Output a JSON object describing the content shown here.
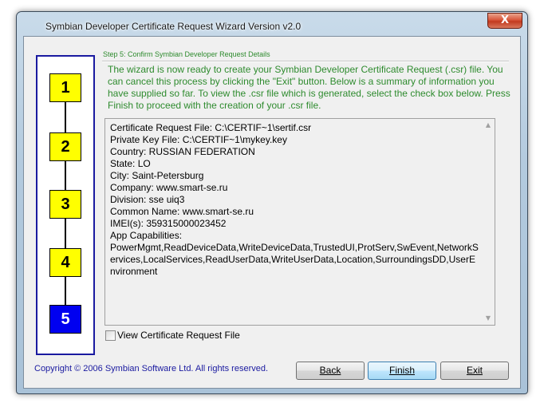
{
  "window": {
    "title": "Symbian Developer Certificate Request Wizard Version v2.0",
    "close_label": "X"
  },
  "steps": [
    {
      "label": "1",
      "active": false
    },
    {
      "label": "2",
      "active": false
    },
    {
      "label": "3",
      "active": false
    },
    {
      "label": "4",
      "active": false
    },
    {
      "label": "5",
      "active": true
    }
  ],
  "page": {
    "heading": "Step 5: Confirm Symbian Developer Request Details",
    "intro": "The wizard is now ready to create your Symbian Developer Certificate Request (.csr) file. You can cancel this process by clicking the \"Exit\" button. Below is a summary of information you have supplied so far. To view the .csr file which is generated, select the check box below. Press Finish to proceed with the creation of your .csr file."
  },
  "summary": {
    "lines": [
      "Certificate Request File: C:\\CERTIF~1\\sertif.csr",
      "Private Key File: C:\\CERTIF~1\\mykey.key",
      "Country: RUSSIAN FEDERATION",
      "State: LO",
      "City: Saint-Petersburg",
      "Company: www.smart-se.ru",
      "Division: sse uiq3",
      "Common Name: www.smart-se.ru",
      "IMEI(s): 359315000023452",
      "App Capabilities:"
    ],
    "capabilities": "PowerMgmt,ReadDeviceData,WriteDeviceData,TrustedUI,ProtServ,SwEvent,NetworkServices,LocalServices,ReadUserData,WriteUserData,Location,SurroundingsDD,UserEnvironment"
  },
  "view_checkbox": {
    "label": "View Certificate Request File",
    "checked": false
  },
  "footer": {
    "copyright": "Copyright © 2006 Symbian Software Ltd. All rights reserved."
  },
  "buttons": {
    "back": "Back",
    "finish": "Finish",
    "exit": "Exit"
  }
}
